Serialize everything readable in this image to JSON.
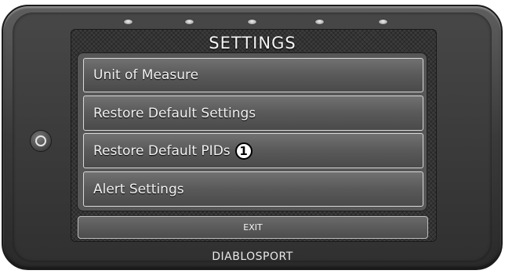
{
  "screen": {
    "title": "SETTINGS"
  },
  "menu": {
    "items": [
      {
        "label": "Unit of Measure"
      },
      {
        "label": "Restore Default Settings"
      },
      {
        "label": "Restore Default PIDs",
        "callout": "1"
      },
      {
        "label": "Alert Settings"
      }
    ]
  },
  "footer": {
    "exit_label": "EXIT",
    "brand": "DIABLOSPORT"
  },
  "icons": {
    "power_button": "power-button-icon",
    "indicator_leds": "indicator-led-icon"
  },
  "colors": {
    "bezel": "#3a3a3a",
    "screen": "#3b3b3b",
    "menu_item": "#5a5a5a",
    "item_border": "#d9d9d9",
    "text": "#f2f2f2"
  }
}
